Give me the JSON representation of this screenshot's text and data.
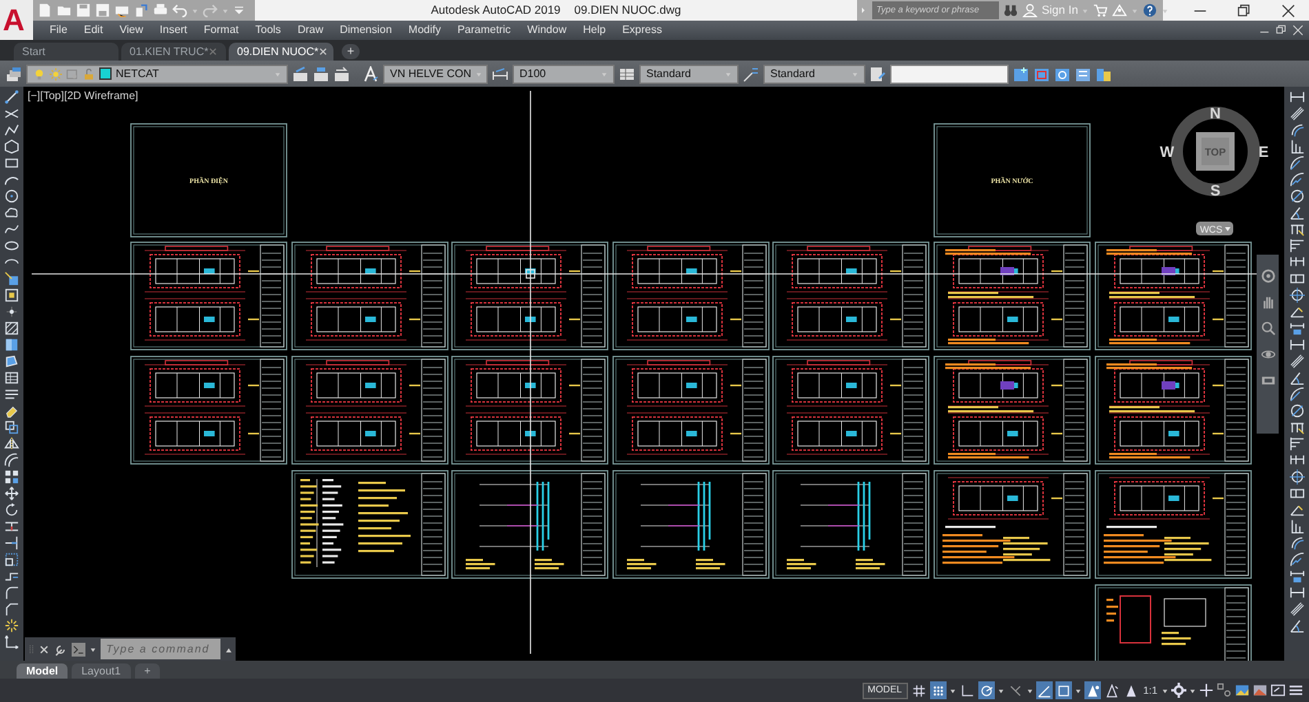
{
  "app_button": {
    "label": "A"
  },
  "title_bar": {
    "app_title": "Autodesk AutoCAD 2019",
    "file_name": "09.DIEN NUOC.dwg",
    "search": {
      "placeholder": "Type a keyword or phrase"
    },
    "sign_in": "Sign In"
  },
  "menu": [
    "File",
    "Edit",
    "View",
    "Insert",
    "Format",
    "Tools",
    "Draw",
    "Dimension",
    "Modify",
    "Parametric",
    "Window",
    "Help",
    "Express"
  ],
  "file_tabs": [
    {
      "label": "Start",
      "selected": false,
      "closable": false
    },
    {
      "label": "01.KIEN TRUC*",
      "selected": false,
      "closable": true
    },
    {
      "label": "09.DIEN NUOC*",
      "selected": true,
      "closable": true
    }
  ],
  "new_tab": "+",
  "properties_toolbar": {
    "layer": {
      "name": "NETCAT",
      "color": "#19d3d3"
    },
    "text_style": "VN HELVE CON",
    "dim_style": "D100",
    "table_style": "Standard",
    "multileader_style": "Standard"
  },
  "viewport_controls": [
    "[−]",
    "[Top]",
    "[2D Wireframe]"
  ],
  "view_cube": {
    "north": "N",
    "south": "S",
    "east": "E",
    "west": "W",
    "face": "TOP",
    "ucs": "WCS"
  },
  "sheet_rows": [
    {
      "sheets": [
        {
          "kind": "cover",
          "title": "PHẦN ĐIỆN"
        },
        {
          "kind": "empty"
        },
        {
          "kind": "empty"
        },
        {
          "kind": "empty"
        },
        {
          "kind": "empty"
        },
        {
          "kind": "cover",
          "title": "PHẦN NƯỚC"
        },
        {
          "kind": "empty"
        }
      ]
    },
    {
      "sheets": [
        {
          "kind": "plan"
        },
        {
          "kind": "plan"
        },
        {
          "kind": "plan"
        },
        {
          "kind": "plan"
        },
        {
          "kind": "plan"
        },
        {
          "kind": "plan-annotated"
        },
        {
          "kind": "plan-annotated"
        }
      ]
    },
    {
      "sheets": [
        {
          "kind": "plan"
        },
        {
          "kind": "plan"
        },
        {
          "kind": "plan"
        },
        {
          "kind": "plan"
        },
        {
          "kind": "plan"
        },
        {
          "kind": "plan-annotated"
        },
        {
          "kind": "plan-annotated"
        }
      ]
    },
    {
      "sheets": [
        {
          "kind": "empty"
        },
        {
          "kind": "legend"
        },
        {
          "kind": "riser"
        },
        {
          "kind": "riser"
        },
        {
          "kind": "riser"
        },
        {
          "kind": "plan-schedule"
        },
        {
          "kind": "plan-schedule"
        }
      ]
    },
    {
      "sheets": [
        {
          "kind": "empty"
        },
        {
          "kind": "empty"
        },
        {
          "kind": "empty"
        },
        {
          "kind": "empty"
        },
        {
          "kind": "empty"
        },
        {
          "kind": "empty"
        },
        {
          "kind": "detail"
        }
      ]
    }
  ],
  "command_line": {
    "placeholder": "Type a command"
  },
  "layout_tabs": [
    {
      "label": "Model",
      "selected": true
    },
    {
      "label": "Layout1",
      "selected": false
    }
  ],
  "new_layout": "+",
  "status_bar": {
    "model": "MODEL",
    "scale": "1:1",
    "toggles": [
      {
        "kind": "grid",
        "on": false
      },
      {
        "kind": "snap",
        "on": true
      },
      {
        "kind": "ortho",
        "on": false
      },
      {
        "kind": "polar",
        "on": true
      },
      {
        "kind": "isodraft",
        "on": false
      },
      {
        "kind": "object-snap-tracking",
        "on": true
      },
      {
        "kind": "object-snap",
        "on": true
      },
      {
        "kind": "annotation-visibility",
        "on": true
      },
      {
        "kind": "auto-scale",
        "on": false
      },
      {
        "kind": "annotation-scale",
        "on": false
      }
    ]
  }
}
